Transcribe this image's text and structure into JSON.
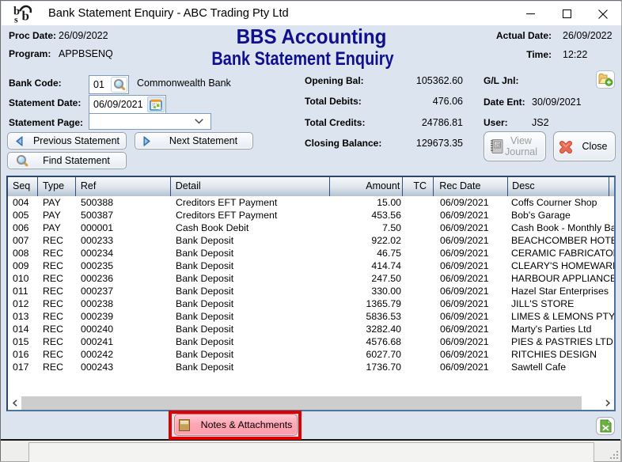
{
  "window": {
    "title": "Bank Statement Enquiry - ABC Trading Pty Ltd",
    "controls": [
      "minimize",
      "maximize",
      "close"
    ]
  },
  "header": {
    "proc_date_label": "Proc Date:",
    "proc_date": "26/09/2022",
    "program_label": "Program:",
    "program": "APPBSENQ",
    "app_title": "BBS Accounting",
    "screen_title": "Bank Statement Enquiry",
    "actual_date_label": "Actual Date:",
    "actual_date": "26/09/2022",
    "time_label": "Time:",
    "time": "12:22"
  },
  "form": {
    "bank_code_label": "Bank Code:",
    "bank_code": "01",
    "bank_name": "Commonwealth Bank",
    "statement_date_label": "Statement Date:",
    "statement_date": "06/09/2021",
    "statement_page_label": "Statement Page:",
    "statement_page": "",
    "prev_button": "Previous Statement",
    "next_button": "Next Statement",
    "find_button": "Find Statement"
  },
  "summary": {
    "opening_bal_label": "Opening Bal:",
    "opening_bal": "105362.60",
    "total_debits_label": "Total Debits:",
    "total_debits": "476.06",
    "total_credits_label": "Total Credits:",
    "total_credits": "24786.81",
    "closing_balance_label": "Closing Balance:",
    "closing_balance": "129673.35"
  },
  "journal": {
    "gl_jnl_label": "G/L Jnl:",
    "date_ent_label": "Date Ent:",
    "date_ent": "30/09/2021",
    "user_label": "User:",
    "user": "JS2",
    "view_journal_button": "View Journal",
    "close_button": "Close"
  },
  "table": {
    "columns": [
      "Seq",
      "Type",
      "Ref",
      "Detail",
      "Amount",
      "TC",
      "Rec Date",
      "Desc"
    ],
    "rows": [
      [
        "004",
        "PAY",
        "500388",
        "Creditors EFT Payment",
        "15.00",
        "",
        "06/09/2021",
        "Coffs Courner Shop"
      ],
      [
        "005",
        "PAY",
        "500387",
        "Creditors EFT Payment",
        "453.56",
        "",
        "06/09/2021",
        "Bob's Garage"
      ],
      [
        "006",
        "PAY",
        "000001",
        "Cash Book Debit",
        "7.50",
        "",
        "06/09/2021",
        "Cash Book - Monthly Bank"
      ],
      [
        "007",
        "REC",
        "000233",
        "Bank Deposit",
        "922.02",
        "",
        "06/09/2021",
        "BEACHCOMBER HOTEL"
      ],
      [
        "008",
        "REC",
        "000234",
        "Bank Deposit",
        "46.75",
        "",
        "06/09/2021",
        "CERAMIC FABRICATORS"
      ],
      [
        "009",
        "REC",
        "000235",
        "Bank Deposit",
        "414.74",
        "",
        "06/09/2021",
        "CLEARY'S HOMEWARES"
      ],
      [
        "010",
        "REC",
        "000236",
        "Bank Deposit",
        "247.50",
        "",
        "06/09/2021",
        "HARBOUR APPLIANCES"
      ],
      [
        "011",
        "REC",
        "000237",
        "Bank Deposit",
        "330.00",
        "",
        "06/09/2021",
        "Hazel Star Enterprises"
      ],
      [
        "012",
        "REC",
        "000238",
        "Bank Deposit",
        "1365.79",
        "",
        "06/09/2021",
        "JILL'S STORE"
      ],
      [
        "013",
        "REC",
        "000239",
        "Bank Deposit",
        "5836.53",
        "",
        "06/09/2021",
        "LIMES & LEMONS PTY LTD"
      ],
      [
        "014",
        "REC",
        "000240",
        "Bank Deposit",
        "3282.40",
        "",
        "06/09/2021",
        "Marty's Parties Ltd"
      ],
      [
        "015",
        "REC",
        "000241",
        "Bank Deposit",
        "4576.68",
        "",
        "06/09/2021",
        "PIES & PASTRIES LTD"
      ],
      [
        "016",
        "REC",
        "000242",
        "Bank Deposit",
        "6027.70",
        "",
        "06/09/2021",
        "RITCHIES DESIGN"
      ],
      [
        "017",
        "REC",
        "000243",
        "Bank Deposit",
        "1736.70",
        "",
        "06/09/2021",
        "Sawtell Cafe"
      ]
    ]
  },
  "bottom": {
    "notes_button": "Notes & Attachments"
  },
  "icons": {
    "app": "bbs-logo",
    "bank_code": "magnifier-icon",
    "statement_date": "calendar-icon",
    "prev": "left-triangle-icon",
    "next": "right-triangle-icon",
    "find": "magnifier-icon",
    "gl_jnl": "folder-plus-icon",
    "view_journal": "journal-book-icon",
    "close": "red-x-icon",
    "notes": "notepad-icon",
    "export": "excel-export-icon"
  },
  "colors": {
    "client_bg": "#dce4f0",
    "title_navy": "#10108e",
    "annotation_red": "#de0000",
    "table_border": "#2c4a6e",
    "status_bg": "#eeeeec"
  }
}
